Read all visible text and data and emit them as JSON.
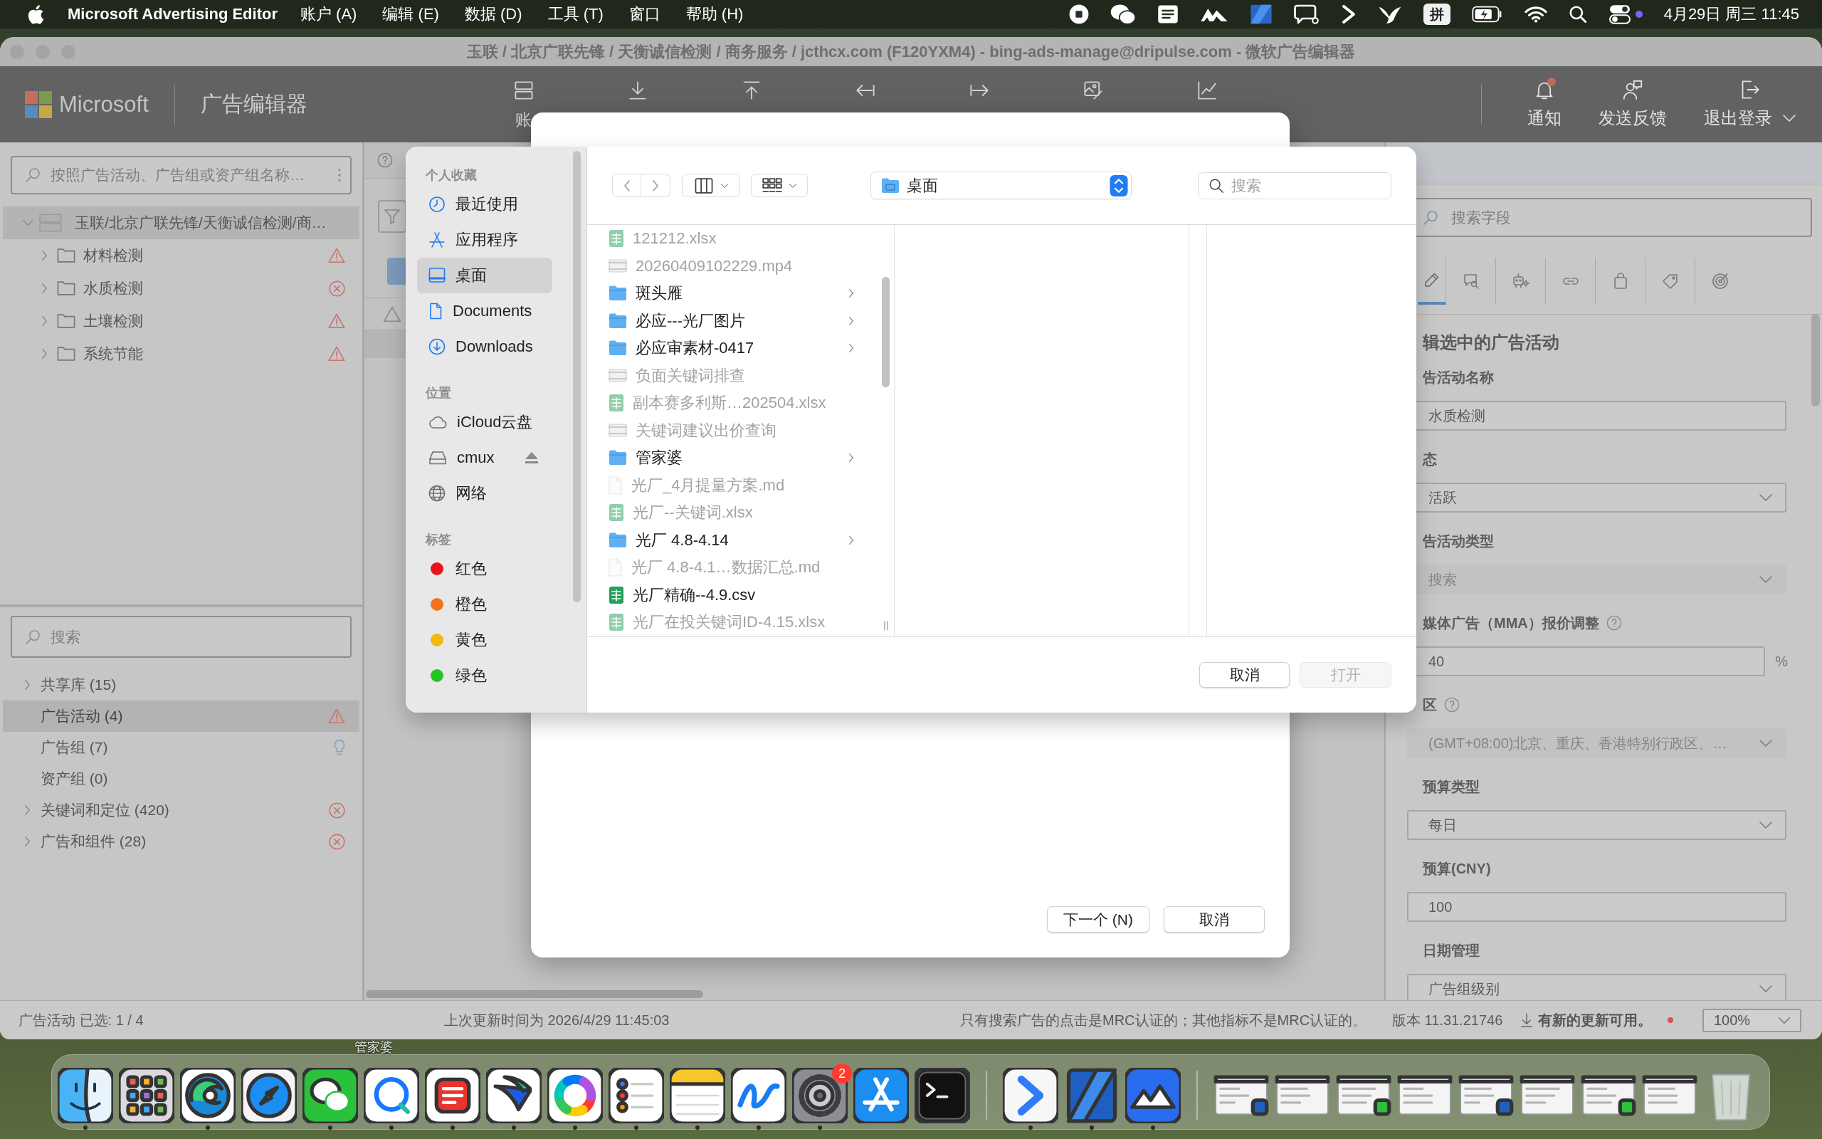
{
  "menu_bar": {
    "app_name": "Microsoft Advertising Editor",
    "menus": [
      "账户 (A)",
      "编辑 (E)",
      "数据 (D)",
      "工具 (T)",
      "窗口",
      "帮助 (H)"
    ],
    "input_method": "拼",
    "clock": "4月29日 周三 11:45"
  },
  "window": {
    "title": "玉联 / 北京广联先锋 / 天衡诚信检测 / 商务服务 / jcthcx.com (F120YXM4) - bing-ads-manage@dripulse.com - 微软广告编辑器",
    "brand": "Microsoft",
    "app_title": "广告编辑器",
    "toolbar_labels": [
      "账"
    ],
    "toolbar_right": [
      {
        "label": "通知",
        "unread": true,
        "menu": false
      },
      {
        "label": "发送反馈",
        "unread": false,
        "menu": false
      },
      {
        "label": "退出登录",
        "unread": false,
        "menu": true
      }
    ]
  },
  "campaign_tree": {
    "search_placeholder": "按照广告活动、广告组或资产组名称…",
    "root": {
      "name": "玉联/北京广联先锋/天衡诚信检测/商…",
      "expanded": true,
      "selected": true,
      "children": [
        {
          "name": "材料检测",
          "expanded": false,
          "selected": false,
          "kind": "warning"
        },
        {
          "name": "水质检测",
          "expanded": false,
          "selected": false,
          "kind": "error"
        },
        {
          "name": "土壤检测",
          "expanded": false,
          "selected": false,
          "kind": "warning"
        },
        {
          "name": "系统节能",
          "expanded": false,
          "selected": false,
          "kind": "warning"
        }
      ]
    }
  },
  "navigator": {
    "search_placeholder": "搜索",
    "items": [
      {
        "label": "共享库 (15)",
        "expandable": true,
        "selected": false,
        "kind": "plain"
      },
      {
        "label": "广告活动 (4)",
        "expandable": false,
        "selected": true,
        "kind": "warning"
      },
      {
        "label": "广告组 (7)",
        "expandable": false,
        "selected": false,
        "kind": "tip"
      },
      {
        "label": "资产组 (0)",
        "expandable": false,
        "selected": false,
        "kind": "plain"
      },
      {
        "label": "关键词和定位 (420)",
        "expandable": true,
        "selected": false,
        "kind": "error"
      },
      {
        "label": "广告和组件 (28)",
        "expandable": true,
        "selected": false,
        "kind": "error"
      }
    ]
  },
  "import_sheet": {
    "buttons": [
      "下一个 (N)",
      "取消"
    ]
  },
  "file_picker": {
    "sidebar": [
      {
        "heading": "个人收藏",
        "items": [
          {
            "label": "最近使用",
            "kind": "recents",
            "selected": false
          },
          {
            "label": "应用程序",
            "kind": "applications",
            "selected": false
          },
          {
            "label": "桌面",
            "kind": "desktop",
            "selected": true
          },
          {
            "label": "Documents",
            "kind": "documents",
            "selected": false
          },
          {
            "label": "Downloads",
            "kind": "downloads",
            "selected": false
          }
        ]
      },
      {
        "heading": "位置",
        "items": [
          {
            "label": "iCloud云盘",
            "kind": "icloud",
            "selected": false
          },
          {
            "label": "cmux",
            "kind": "drive",
            "selected": false
          },
          {
            "label": "网络",
            "kind": "network",
            "selected": false
          }
        ]
      },
      {
        "heading": "标签",
        "items": [
          {
            "label": "红色",
            "kind": "tag",
            "color": "#e8141c",
            "selected": false
          },
          {
            "label": "橙色",
            "kind": "tag",
            "color": "#f2741a",
            "selected": false
          },
          {
            "label": "黄色",
            "kind": "tag",
            "color": "#f2b90d",
            "selected": false
          },
          {
            "label": "绿色",
            "kind": "tag",
            "color": "#26c426",
            "selected": false
          }
        ]
      }
    ],
    "location": "桌面",
    "search_placeholder": "搜索",
    "files": [
      {
        "name": "121212.xlsx",
        "kind": "spreadsheet",
        "disabled": true
      },
      {
        "name": "20260409102229.mp4",
        "kind": "media",
        "disabled": true
      },
      {
        "name": "斑头雁",
        "kind": "folder",
        "disabled": false
      },
      {
        "name": "必应---光厂图片",
        "kind": "folder",
        "disabled": false
      },
      {
        "name": "必应审素材-0417",
        "kind": "folder",
        "disabled": false
      },
      {
        "name": "负面关键词排查",
        "kind": "media",
        "disabled": true
      },
      {
        "name": "副本赛多利斯…202504.xlsx",
        "kind": "spreadsheet",
        "disabled": true
      },
      {
        "name": "关键词建议出价查询",
        "kind": "media",
        "disabled": true
      },
      {
        "name": "管家婆",
        "kind": "folder",
        "disabled": false
      },
      {
        "name": "光厂_4月提量方案.md",
        "kind": "text",
        "disabled": true
      },
      {
        "name": "光厂--关键词.xlsx",
        "kind": "spreadsheet",
        "disabled": true
      },
      {
        "name": "光厂 4.8-4.14",
        "kind": "folder",
        "disabled": false
      },
      {
        "name": "光厂 4.8-4.1…数据汇总.md",
        "kind": "text",
        "disabled": true
      },
      {
        "name": "光厂精确--4.9.csv",
        "kind": "spreadsheet",
        "disabled": false
      },
      {
        "name": "光厂在投关键词ID-4.15.xlsx",
        "kind": "spreadsheet",
        "disabled": true
      }
    ],
    "buttons": [
      {
        "label": "取消",
        "disabled": false
      },
      {
        "label": "打开",
        "disabled": true
      }
    ]
  },
  "properties_panel": {
    "search_placeholder": "搜索字段",
    "tabs": [
      {
        "selected": true
      },
      {
        "selected": false
      },
      {
        "selected": false
      },
      {
        "selected": false
      },
      {
        "selected": false
      },
      {
        "selected": false
      },
      {
        "selected": false
      }
    ],
    "heading": "辑选中的广告活动",
    "fields": [
      {
        "label": "告活动名称",
        "kind": "text",
        "value": "水质检测",
        "disabled": false,
        "help": false
      },
      {
        "label": "态",
        "kind": "select",
        "value": "活跃",
        "disabled": false,
        "help": false
      },
      {
        "label": "告活动类型",
        "kind": "select",
        "value": "搜索",
        "disabled": true,
        "help": false
      },
      {
        "label": "媒体广告（MMA）报价调整",
        "kind": "percent",
        "value": "40",
        "unit": "%",
        "disabled": false,
        "help": true
      },
      {
        "label": "区",
        "kind": "select",
        "value": "(GMT+08:00)北京、重庆、香港特别行政区、…",
        "disabled": true,
        "help": true
      },
      {
        "label": "预算类型",
        "kind": "select",
        "value": "每日",
        "disabled": false,
        "help": false
      },
      {
        "label": "预算(CNY)",
        "kind": "text",
        "value": "100",
        "disabled": false,
        "help": false
      },
      {
        "label": "日期管理",
        "kind": "select",
        "value": "广告组级别",
        "disabled": false,
        "help": false
      }
    ]
  },
  "status_bar": {
    "selection": "广告活动 已选: 1 / 4",
    "last_update": "上次更新时间为 2026/4/29 11:45:03",
    "mrc_note": "只有搜索广告的点击是MRC认证的；其他指标不是MRC认证的。",
    "version": "版本 11.31.21746",
    "update_notice": "有新的更新可用。",
    "zoom": "100%"
  },
  "desktop_label": "管家婆",
  "dock": {
    "apps": [
      {
        "running": true
      },
      {
        "running": false
      },
      {
        "running": true
      },
      {
        "running": false
      },
      {
        "running": true
      },
      {
        "running": true
      },
      {
        "running": true
      },
      {
        "running": true
      },
      {
        "running": true
      },
      {
        "running": true
      },
      {
        "running": true
      },
      {
        "running": true
      },
      {
        "running": true,
        "badge": "2"
      },
      {
        "running": false
      },
      {
        "running": false
      },
      {
        "running": true
      },
      {
        "running": true
      },
      {
        "running": true
      }
    ]
  }
}
